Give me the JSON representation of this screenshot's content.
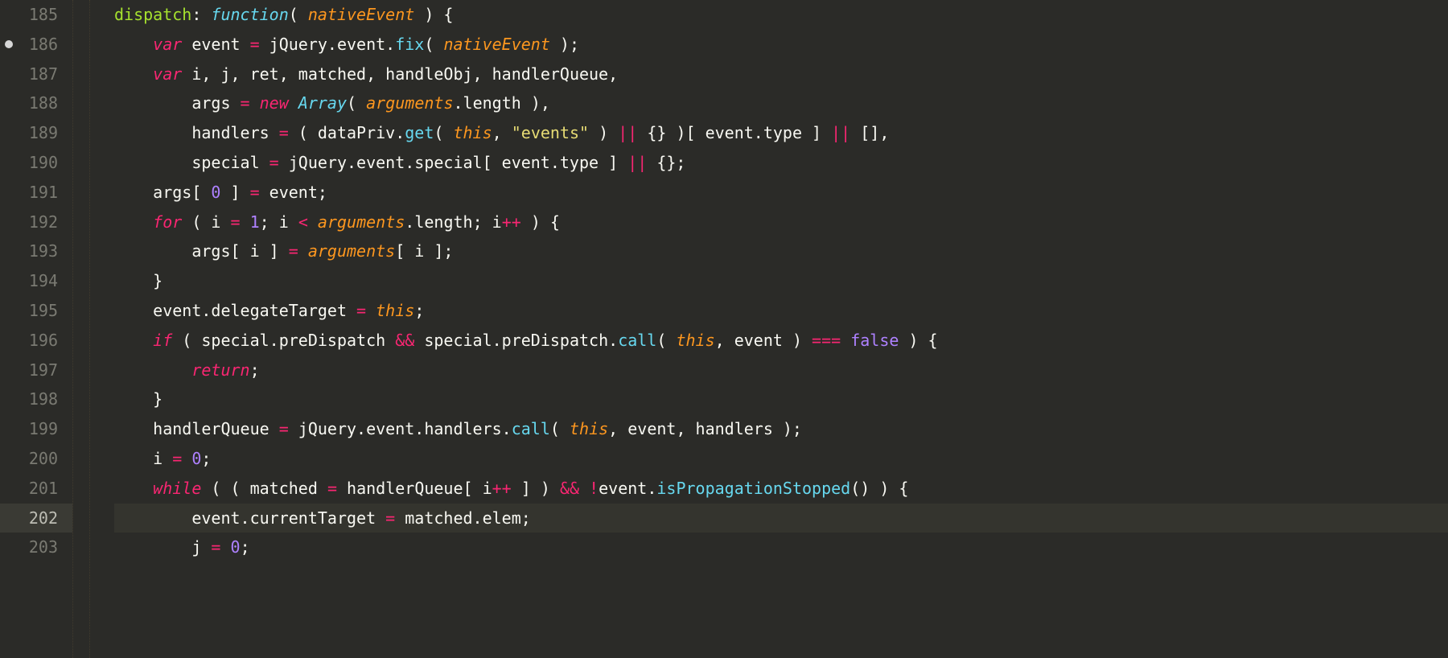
{
  "gutter": {
    "start": 185,
    "end": 203,
    "modified": [
      186
    ],
    "active": 202
  },
  "code": {
    "lines": [
      {
        "indent": 0,
        "tokens": [
          [
            "name",
            "dispatch"
          ],
          [
            "p",
            ": "
          ],
          [
            "fn",
            "function"
          ],
          [
            "p",
            "( "
          ],
          [
            "param",
            "nativeEvent"
          ],
          [
            "p",
            " ) {"
          ]
        ]
      },
      {
        "indent": 1,
        "tokens": [
          [
            "kw",
            "var"
          ],
          [
            "p",
            " event "
          ],
          [
            "kw2",
            "="
          ],
          [
            "p",
            " jQuery.event."
          ],
          [
            "method",
            "fix"
          ],
          [
            "p",
            "( "
          ],
          [
            "param",
            "nativeEvent"
          ],
          [
            "p",
            " );"
          ]
        ]
      },
      {
        "indent": 1,
        "tokens": [
          [
            "kw",
            "var"
          ],
          [
            "p",
            " i, j, ret, matched, handleObj, handlerQueue,"
          ]
        ]
      },
      {
        "indent": 2,
        "tokens": [
          [
            "p",
            "args "
          ],
          [
            "kw2",
            "="
          ],
          [
            "p",
            " "
          ],
          [
            "kw",
            "new"
          ],
          [
            "p",
            " "
          ],
          [
            "type",
            "Array"
          ],
          [
            "p",
            "( "
          ],
          [
            "param",
            "arguments"
          ],
          [
            "p",
            ".length ),"
          ]
        ]
      },
      {
        "indent": 2,
        "tokens": [
          [
            "p",
            "handlers "
          ],
          [
            "kw2",
            "="
          ],
          [
            "p",
            " ( dataPriv."
          ],
          [
            "method",
            "get"
          ],
          [
            "p",
            "( "
          ],
          [
            "param",
            "this"
          ],
          [
            "p",
            ", "
          ],
          [
            "str",
            "\"events\""
          ],
          [
            "p",
            " ) "
          ],
          [
            "kw2",
            "||"
          ],
          [
            "p",
            " {} )[ event.type ] "
          ],
          [
            "kw2",
            "||"
          ],
          [
            "p",
            " [],"
          ]
        ]
      },
      {
        "indent": 2,
        "tokens": [
          [
            "p",
            "special "
          ],
          [
            "kw2",
            "="
          ],
          [
            "p",
            " jQuery.event.special[ event.type ] "
          ],
          [
            "kw2",
            "||"
          ],
          [
            "p",
            " {};"
          ]
        ]
      },
      {
        "indent": 1,
        "tokens": [
          [
            "p",
            "args[ "
          ],
          [
            "num",
            "0"
          ],
          [
            "p",
            " ] "
          ],
          [
            "kw2",
            "="
          ],
          [
            "p",
            " event;"
          ]
        ]
      },
      {
        "indent": 1,
        "tokens": [
          [
            "kw",
            "for"
          ],
          [
            "p",
            " ( i "
          ],
          [
            "kw2",
            "="
          ],
          [
            "p",
            " "
          ],
          [
            "num",
            "1"
          ],
          [
            "p",
            "; i "
          ],
          [
            "kw2",
            "<"
          ],
          [
            "p",
            " "
          ],
          [
            "param",
            "arguments"
          ],
          [
            "p",
            ".length; i"
          ],
          [
            "kw2",
            "++"
          ],
          [
            "p",
            " ) {"
          ]
        ]
      },
      {
        "indent": 2,
        "tokens": [
          [
            "p",
            "args[ i ] "
          ],
          [
            "kw2",
            "="
          ],
          [
            "p",
            " "
          ],
          [
            "param",
            "arguments"
          ],
          [
            "p",
            "[ i ];"
          ]
        ]
      },
      {
        "indent": 1,
        "tokens": [
          [
            "p",
            "}"
          ]
        ]
      },
      {
        "indent": 1,
        "tokens": [
          [
            "p",
            "event.delegateTarget "
          ],
          [
            "kw2",
            "="
          ],
          [
            "p",
            " "
          ],
          [
            "param",
            "this"
          ],
          [
            "p",
            ";"
          ]
        ]
      },
      {
        "indent": 1,
        "tokens": [
          [
            "kw",
            "if"
          ],
          [
            "p",
            " ( special.preDispatch "
          ],
          [
            "kw2",
            "&&"
          ],
          [
            "p",
            " special.preDispatch."
          ],
          [
            "method",
            "call"
          ],
          [
            "p",
            "( "
          ],
          [
            "param",
            "this"
          ],
          [
            "p",
            ", event ) "
          ],
          [
            "kw2",
            "==="
          ],
          [
            "p",
            " "
          ],
          [
            "bool",
            "false"
          ],
          [
            "p",
            " ) {"
          ]
        ]
      },
      {
        "indent": 2,
        "tokens": [
          [
            "kw",
            "return"
          ],
          [
            "p",
            ";"
          ]
        ]
      },
      {
        "indent": 1,
        "tokens": [
          [
            "p",
            "}"
          ]
        ]
      },
      {
        "indent": 1,
        "tokens": [
          [
            "p",
            "handlerQueue "
          ],
          [
            "kw2",
            "="
          ],
          [
            "p",
            " jQuery.event.handlers."
          ],
          [
            "method",
            "call"
          ],
          [
            "p",
            "( "
          ],
          [
            "param",
            "this"
          ],
          [
            "p",
            ", event, handlers );"
          ]
        ]
      },
      {
        "indent": 1,
        "tokens": [
          [
            "p",
            "i "
          ],
          [
            "kw2",
            "="
          ],
          [
            "p",
            " "
          ],
          [
            "num",
            "0"
          ],
          [
            "p",
            ";"
          ]
        ]
      },
      {
        "indent": 1,
        "tokens": [
          [
            "kw",
            "while"
          ],
          [
            "p",
            " ( ( matched "
          ],
          [
            "kw2",
            "="
          ],
          [
            "p",
            " handlerQueue[ i"
          ],
          [
            "kw2",
            "++"
          ],
          [
            "p",
            " ] ) "
          ],
          [
            "kw2",
            "&&"
          ],
          [
            "p",
            " "
          ],
          [
            "kw2",
            "!"
          ],
          [
            "p",
            "event."
          ],
          [
            "method",
            "isPropagationStopped"
          ],
          [
            "p",
            "() ) {"
          ]
        ]
      },
      {
        "indent": 2,
        "active": true,
        "tokens": [
          [
            "p",
            "event.currentTarget "
          ],
          [
            "kw2",
            "="
          ],
          [
            "p",
            " matched.elem;"
          ]
        ]
      },
      {
        "indent": 2,
        "tokens": [
          [
            "p",
            "j "
          ],
          [
            "kw2",
            "="
          ],
          [
            "p",
            " "
          ],
          [
            "num",
            "0"
          ],
          [
            "p",
            ";"
          ]
        ]
      }
    ],
    "indentUnit": "    "
  }
}
